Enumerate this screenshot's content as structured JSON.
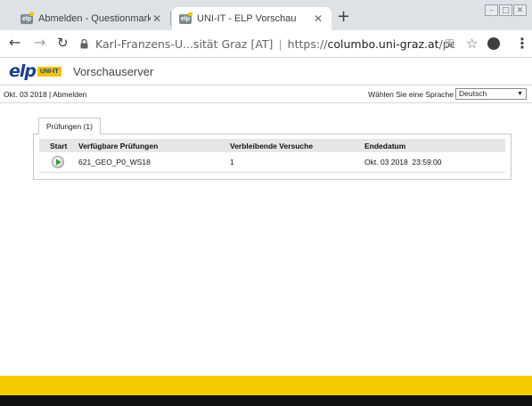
{
  "browser": {
    "tabs": [
      {
        "title": "Abmelden - Questionmark",
        "active": false
      },
      {
        "title": "UNI-IT - ELP Vorschau",
        "active": true
      }
    ],
    "new_tab_label": "+",
    "omnibox": {
      "site_name": "Karl-Franzens-U...sität Graz [AT]",
      "url_prefix": "https://",
      "url_host": "columbo.uni-graz.at",
      "url_path": "/percepti..."
    }
  },
  "header": {
    "logo_text": "elp",
    "logo_badge": "UNI-IT",
    "title": "Vorschauserver"
  },
  "infobar": {
    "date_user": "Okt. 03 2018 | Abmelden",
    "language_label": "Wählen Sie eine Sprache",
    "language_value": "Deutsch"
  },
  "panel": {
    "tab_label": "Prüfungen (1)",
    "columns": [
      "Start",
      "Verfügbare Prüfungen",
      "Verbleibende Versuche",
      "Endedatum"
    ],
    "rows": [
      {
        "exam": "621_GEO_P0_WS18",
        "attempts": "1",
        "end_date": "Okt. 03 2018  23:59:00"
      }
    ]
  },
  "colors": {
    "accent_yellow": "#f5cb00",
    "logo_blue": "#1b3f8f",
    "play_green": "#2e9a2e"
  }
}
